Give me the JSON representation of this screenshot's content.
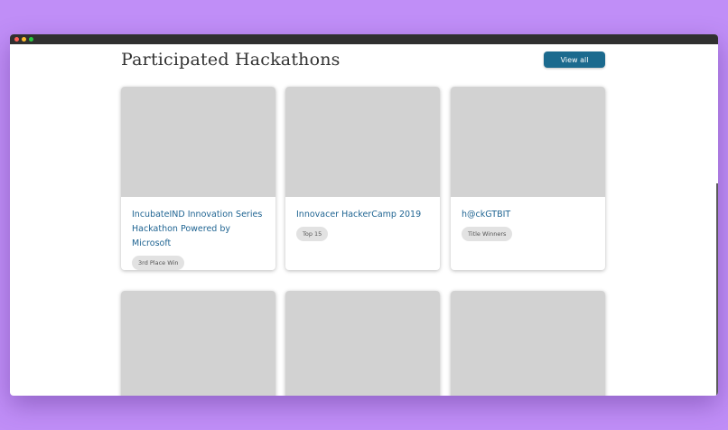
{
  "section": {
    "title": "Participated Hackathons",
    "view_all_label": "View all"
  },
  "hackathons": [
    {
      "name": "IncubateIND Innovation Series Hackathon Powered by Microsoft",
      "badge": "3rd Place Win"
    },
    {
      "name": "Innovacer HackerCamp 2019",
      "badge": "Top 15"
    },
    {
      "name": "h@ckGTBIT",
      "badge": "Title Winners"
    }
  ],
  "colors": {
    "background": "#c08ef7",
    "button": "#1b6a8e",
    "link": "#1f6492",
    "placeholder": "#d2d2d2",
    "badge": "#e2e2e2"
  }
}
